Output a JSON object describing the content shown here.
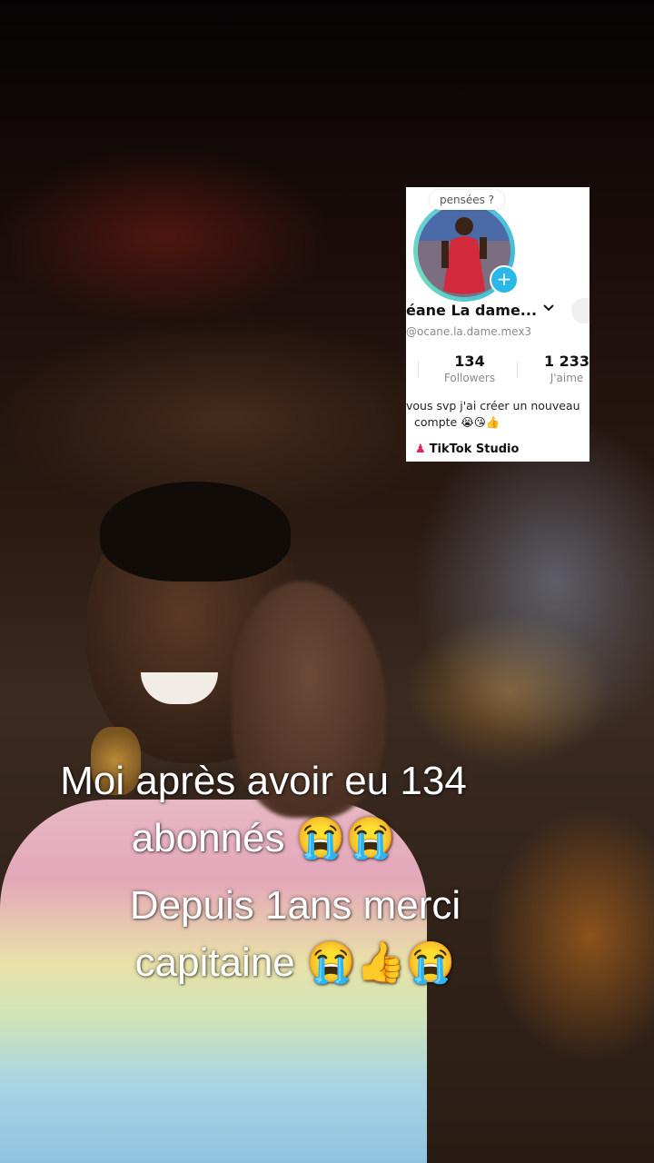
{
  "overlay_profile": {
    "thought_bubble": "pensées ?",
    "display_name": "éane La dame...",
    "chevron": "⌄",
    "handle": "@ocane.la.dame.mex3",
    "followers_count": "134",
    "followers_label": "Followers",
    "likes_count": "1 233",
    "likes_label": "J'aime",
    "bio_line1": "vous svp j'ai créer un nouveau",
    "bio_line2": "compte 😭😘👍",
    "studio_label": "TikTok Studio",
    "plus_icon": "+",
    "ring_color": "#3bb9d8",
    "plus_color": "#29b8e8"
  },
  "captions": {
    "line1": "Moi après avoir eu 134",
    "line2": "abonnés 😭😭",
    "line3": "Depuis 1ans merci",
    "line4": "capitaine 😭👍😭"
  }
}
